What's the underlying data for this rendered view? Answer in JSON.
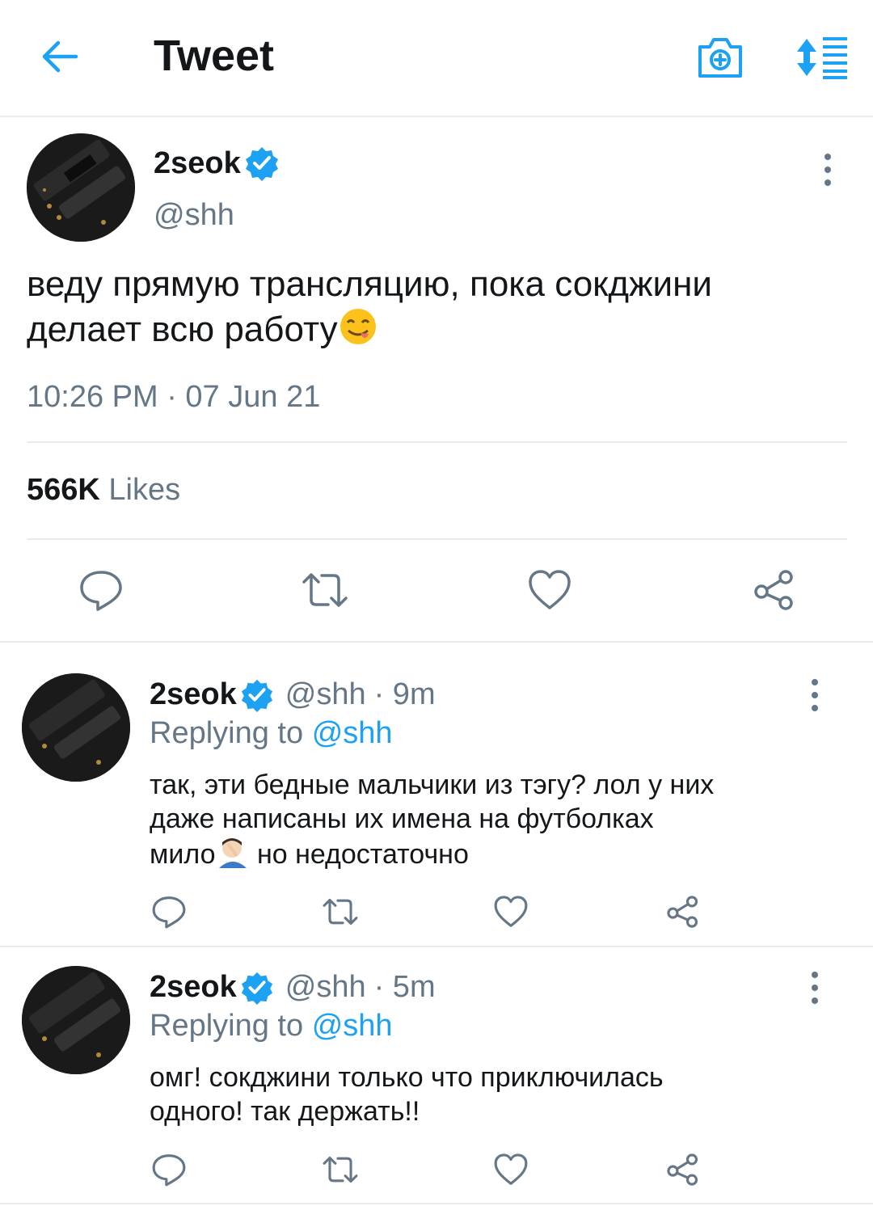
{
  "header": {
    "title": "Tweet",
    "back_icon": "arrow-left-icon",
    "camera_icon": "camera-icon",
    "sort_icon": "sort-list-icon"
  },
  "main_tweet": {
    "author_name": "2seok",
    "author_handle": "@shh",
    "text": "веду прямую трансляцию, пока сокджини делает всю работу",
    "emoji": "😋",
    "timestamp": "10:26 PM · 07 Jun 21",
    "likes_count": "566K",
    "likes_label": "Likes",
    "actions": [
      "reply-icon",
      "retweet-icon",
      "like-icon",
      "share-icon"
    ]
  },
  "replies": [
    {
      "author_name": "2seok",
      "author_handle": "@shh",
      "time": "· 9m",
      "replying_prefix": "Replying to",
      "replying_to": "@shh",
      "text_line1": "так, эти бедные мальчики из тэгу? лол у них",
      "text_line2": "даже написаны их имена на футболках",
      "text_line3a": "мило",
      "text_line3b": " но недостаточно"
    },
    {
      "author_name": "2seok",
      "author_handle": "@shh",
      "time": "· 5m",
      "replying_prefix": "Replying to",
      "replying_to": "@shh",
      "text_line1": "омг! сокджини только что приключилась",
      "text_line2": "одного! так держать!!"
    }
  ],
  "colors": {
    "accent": "#1da1f2",
    "text": "#14171a",
    "secondary": "#657786",
    "divider": "#e6ecf0"
  }
}
